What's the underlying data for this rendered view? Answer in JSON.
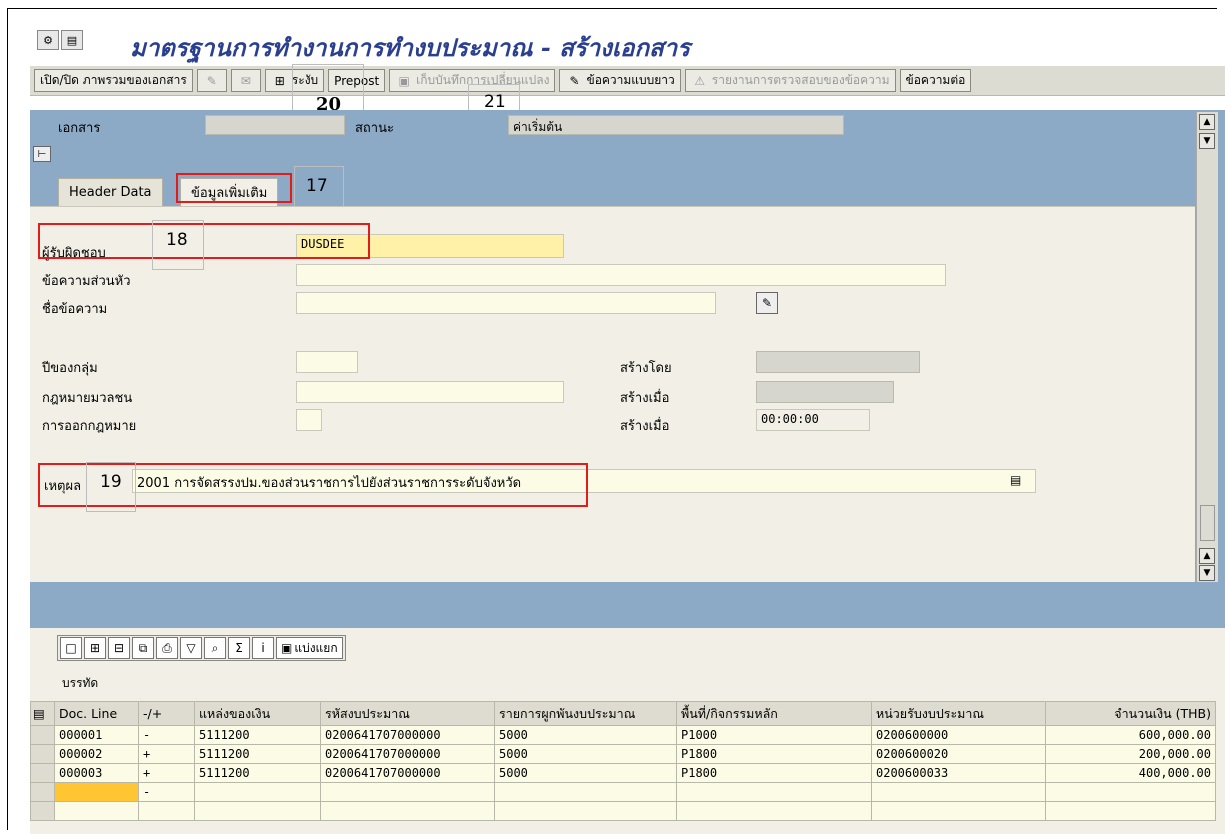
{
  "title": "มาตรฐานการทำงานการทำงบประมาณ - สร้างเอกสาร",
  "toolbar": {
    "overview": "เปิด/ปิด ภาพรวมของเอกสาร",
    "hold": "ระงับ",
    "prepost": "Prepost",
    "save_changes": "เก็บบันทึกการเปลี่ยนแปลง",
    "long_text": "ข้อความแบบยาว",
    "message_report": "รายงานการตรวจสอบของข้อความ",
    "messages": "ข้อความต่อ"
  },
  "header": {
    "doc_label": "เอกสาร",
    "status_label": "สถานะ",
    "status_value": "ค่าเริ่มต้น"
  },
  "tabs": [
    "Header Data",
    "ข้อมูลเพิ่มเติม"
  ],
  "form": {
    "responsible_label": "ผู้รับผิดชอบ",
    "responsible_value": "DUSDEE",
    "header_text_label": "ข้อความส่วนหัว",
    "text_name_label": "ชื่อข้อความ",
    "group_year_label": "ปีของกลุ่ม",
    "public_law_label": "กฎหมายมวลชน",
    "law_issue_label": "การออกกฎหมาย",
    "created_by_label": "สร้างโดย",
    "created_on_label": "สร้างเมื่อ",
    "created_at_label": "สร้างเมื่อ",
    "created_at_value": "00:00:00",
    "reason_label": "เหตุผล",
    "reason_value": "2001 การจัดสรรงปม.ของส่วนราชการไปยังส่วนราชการระดับจังหวัด"
  },
  "annotations": {
    "n17": "17",
    "n18": "18",
    "n19": "19",
    "n20": "20",
    "n21": "21"
  },
  "lower": {
    "split_label": "แบ่งแยก",
    "section_label": "บรรทัด",
    "columns": [
      "Doc. Line",
      "-/+",
      "แหล่งของเงิน",
      "รหัสงบประมาณ",
      "รายการผูกพันงบประมาณ",
      "พื้นที่/กิจกรรมหลัก",
      "หน่วยรับงบประมาณ",
      "จำนวนเงิน (THB)"
    ],
    "rows": [
      [
        "000001",
        "-",
        "5111200",
        "0200641707000000",
        "5000",
        "P1000",
        "0200600000",
        "600,000.00"
      ],
      [
        "000002",
        "+",
        "5111200",
        "0200641707000000",
        "5000",
        "P1800",
        "0200600020",
        "200,000.00"
      ],
      [
        "000003",
        "+",
        "5111200",
        "0200641707000000",
        "5000",
        "P1800",
        "0200600033",
        "400,000.00"
      ],
      [
        "",
        "-",
        "",
        "",
        "",
        "",
        "",
        ""
      ]
    ]
  },
  "colors": {
    "title": "#2a3f8f",
    "panel_blue": "#8ca9c6",
    "highlight_red": "#e21b1b",
    "field_yellow": "#fff2a8"
  }
}
